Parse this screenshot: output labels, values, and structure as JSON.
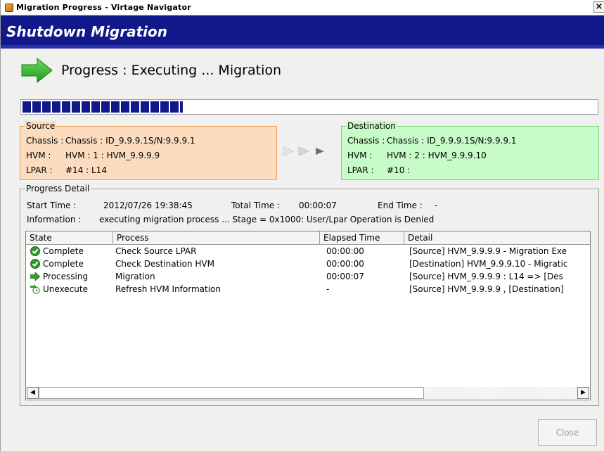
{
  "window": {
    "title": "Migration Progress - Virtage Navigator",
    "close_glyph": "×"
  },
  "banner": {
    "title": "Shutdown Migration"
  },
  "progress": {
    "heading": "Progress : Executing ... Migration",
    "fraction": 0.28,
    "arrow_icon": "green-arrow-icon",
    "accent_color": "#10188a"
  },
  "source": {
    "legend": "Source",
    "rows": [
      {
        "label": "Chassis :",
        "value": "Chassis : ID_9.9.9.1S/N:9.9.9.1"
      },
      {
        "label": "HVM :",
        "value": "HVM : 1 : HVM_9.9.9.9"
      },
      {
        "label": "LPAR :",
        "value": "#14 : L14"
      }
    ],
    "color": "#fbdcbe"
  },
  "destination": {
    "legend": "Destination",
    "rows": [
      {
        "label": "Chassis :",
        "value": "Chassis : ID_9.9.9.1S/N:9.9.9.1"
      },
      {
        "label": "HVM :",
        "value": "HVM : 2 : HVM_9.9.9.10"
      },
      {
        "label": "LPAR :",
        "value": "#10 :"
      }
    ],
    "color": "#c7fbc7"
  },
  "detail": {
    "legend": "Progress Detail",
    "start_time_label": "Start Time :",
    "start_time": "2012/07/26 19:38:45",
    "total_time_label": "Total Time :",
    "total_time": "00:00:07",
    "end_time_label": "End Time :",
    "end_time": "-",
    "information_label": "Information :",
    "information": "executing migration process ... Stage = 0x1000: User/Lpar Operation is Denied",
    "columns": [
      "State",
      "Process",
      "Elapsed Time",
      "Detail"
    ],
    "rows": [
      {
        "icon": "check-icon",
        "state": "Complete",
        "process": "Check Source LPAR",
        "elapsed": "00:00:00",
        "detail": "[Source] HVM_9.9.9.9    - Migration Exe"
      },
      {
        "icon": "check-icon",
        "state": "Complete",
        "process": "Check Destination HVM",
        "elapsed": "00:00:00",
        "detail": "[Destination] HVM_9.9.9.10    - Migratic"
      },
      {
        "icon": "arrow-icon",
        "state": "Processing",
        "process": "Migration",
        "elapsed": "00:00:07",
        "detail": "[Source] HVM_9.9.9.9    : L14 => [Des"
      },
      {
        "icon": "pending-icon",
        "state": "Unexecute",
        "process": "Refresh HVM Information",
        "elapsed": "-",
        "detail": "[Source] HVM_9.9.9.9    , [Destination]"
      }
    ]
  },
  "footer": {
    "close_label": "Close"
  }
}
